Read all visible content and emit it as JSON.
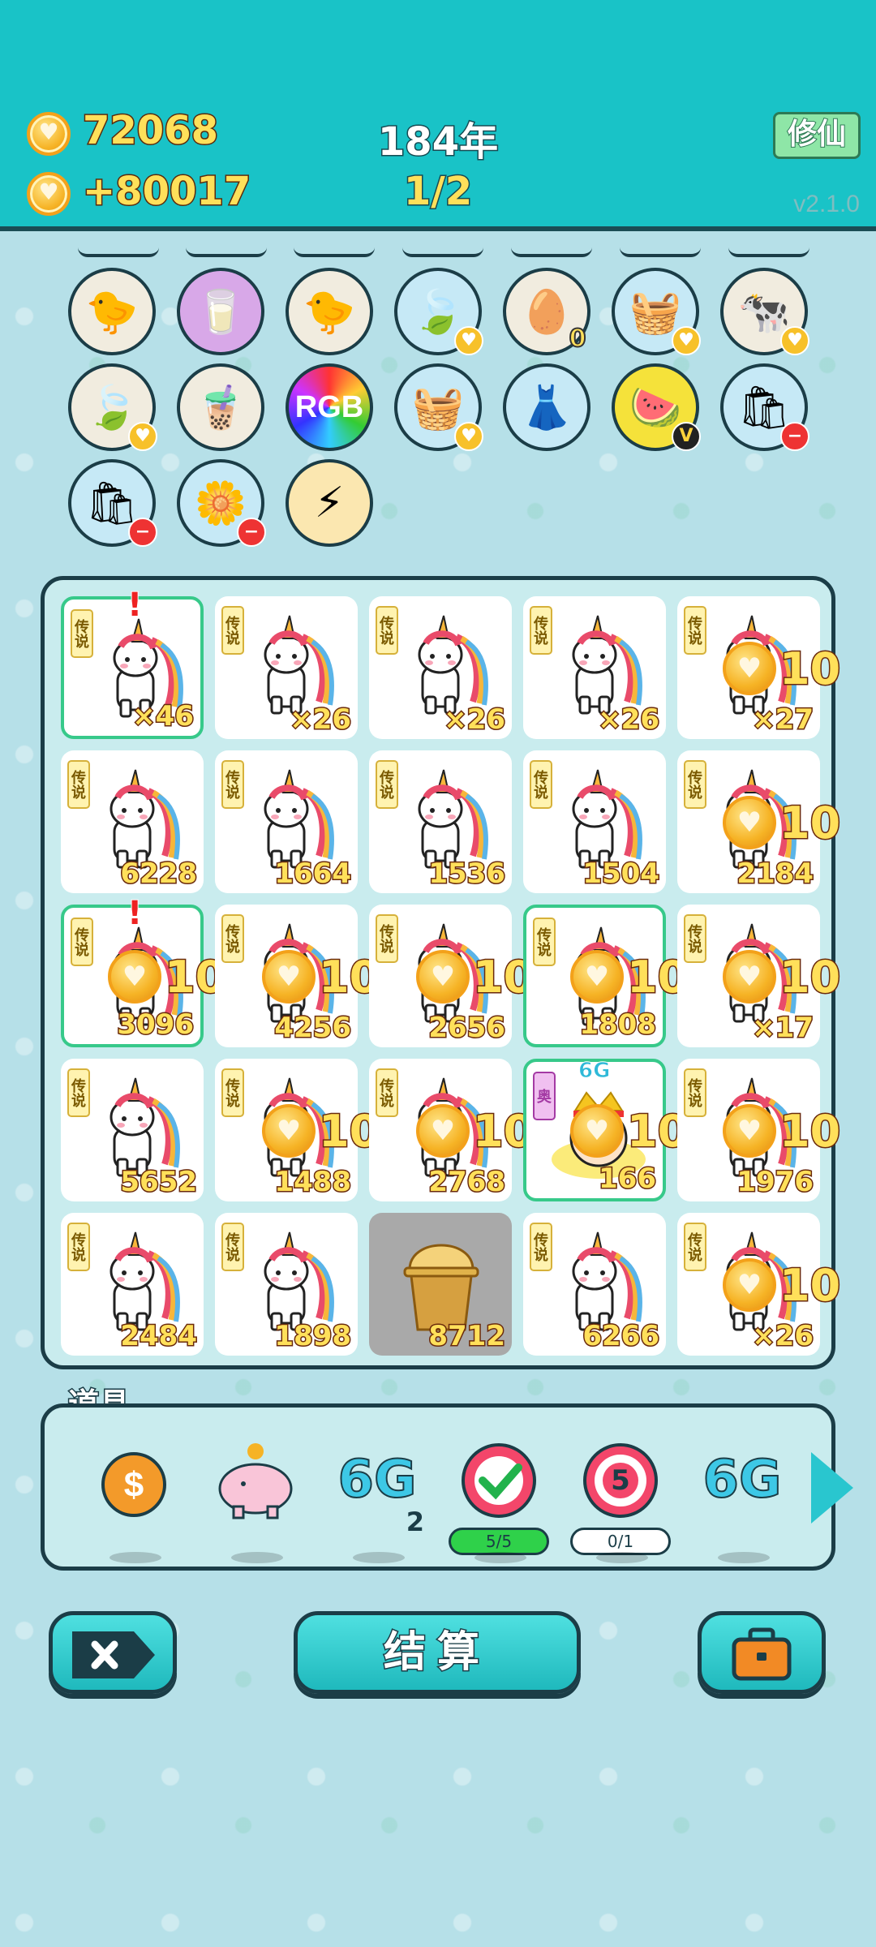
{
  "header": {
    "coins": "72068",
    "rate": "+80017",
    "year": "184年",
    "stage": "1/2",
    "mode_label": "修仙",
    "version": "v2.1.0"
  },
  "shelf": {
    "items": [
      {
        "icon": "chick-egg",
        "emoji": "🐤",
        "bg": "#f1ecdf",
        "badge": ""
      },
      {
        "icon": "milk-jug",
        "emoji": "🥛",
        "bg": "#d8a8e8",
        "badge": ""
      },
      {
        "icon": "chick-egg",
        "emoji": "🐤",
        "bg": "#f1ecdf",
        "badge": ""
      },
      {
        "icon": "leaf",
        "emoji": "🍃",
        "bg": "#c6e9f6",
        "badge": "heart"
      },
      {
        "icon": "egg-tray",
        "emoji": "🥚",
        "bg": "#f1ecdf",
        "badge": "0"
      },
      {
        "icon": "fruit-basket",
        "emoji": "🧺",
        "bg": "#c6e9f6",
        "badge": "heart"
      },
      {
        "icon": "cows",
        "emoji": "🐄",
        "bg": "#f1ecdf",
        "badge": "heart"
      },
      {
        "icon": "leaf",
        "emoji": "🍃",
        "bg": "#f1ecdf",
        "badge": "heart"
      },
      {
        "icon": "bubble-tea",
        "emoji": "🧋",
        "bg": "#f1ecdf",
        "badge": ""
      },
      {
        "icon": "rgb-orb",
        "emoji": "RGB",
        "bg": "#2a2a2a",
        "badge": ""
      },
      {
        "icon": "fruit-basket",
        "emoji": "🧺",
        "bg": "#c6e9f6",
        "badge": "heart"
      },
      {
        "icon": "skirt",
        "emoji": "👗",
        "bg": "#c6e9f6",
        "badge": ""
      },
      {
        "icon": "fruit-platter",
        "emoji": "🍉",
        "bg": "#f5e23a",
        "badge": "V"
      },
      {
        "icon": "sack",
        "emoji": "🛍",
        "bg": "#c6e9f6",
        "badge": "minus"
      },
      {
        "icon": "sack",
        "emoji": "🛍",
        "bg": "#c6e9f6",
        "badge": "minus"
      },
      {
        "icon": "flower-pot",
        "emoji": "🌼",
        "bg": "#c6e9f6",
        "badge": "minus"
      },
      {
        "icon": "lightning",
        "emoji": "⚡",
        "bg": "#fbe7b0",
        "badge": ""
      }
    ]
  },
  "board": {
    "legend_tag": "传说",
    "hero_tag": "奥",
    "float_value": "10",
    "hero_label": "6G",
    "cards": [
      {
        "count": "×46",
        "type": "unicorn",
        "selected": true,
        "alert": true,
        "coin": false
      },
      {
        "count": "×26",
        "type": "unicorn",
        "selected": false,
        "alert": false,
        "coin": false
      },
      {
        "count": "×26",
        "type": "unicorn",
        "selected": false,
        "alert": false,
        "coin": false
      },
      {
        "count": "×26",
        "type": "unicorn",
        "selected": false,
        "alert": false,
        "coin": false
      },
      {
        "count": "×27",
        "type": "unicorn",
        "selected": false,
        "alert": false,
        "coin": true
      },
      {
        "count": "6228",
        "type": "unicorn",
        "selected": false,
        "alert": false,
        "coin": false
      },
      {
        "count": "1664",
        "type": "unicorn",
        "selected": false,
        "alert": false,
        "coin": false
      },
      {
        "count": "1536",
        "type": "unicorn",
        "selected": false,
        "alert": false,
        "coin": false
      },
      {
        "count": "1504",
        "type": "unicorn",
        "selected": false,
        "alert": false,
        "coin": false
      },
      {
        "count": "2184",
        "type": "unicorn",
        "selected": false,
        "alert": false,
        "coin": true
      },
      {
        "count": "3096",
        "type": "unicorn",
        "selected": true,
        "alert": true,
        "coin": true
      },
      {
        "count": "4256",
        "type": "unicorn",
        "selected": false,
        "alert": false,
        "coin": true
      },
      {
        "count": "2656",
        "type": "unicorn",
        "selected": false,
        "alert": false,
        "coin": true
      },
      {
        "count": "1808",
        "type": "unicorn",
        "selected": true,
        "alert": false,
        "coin": true
      },
      {
        "count": "×17",
        "type": "unicorn",
        "selected": false,
        "alert": false,
        "coin": true
      },
      {
        "count": "5652",
        "type": "unicorn",
        "selected": false,
        "alert": false,
        "coin": false
      },
      {
        "count": "1488",
        "type": "unicorn",
        "selected": false,
        "alert": false,
        "coin": true
      },
      {
        "count": "2768",
        "type": "unicorn",
        "selected": false,
        "alert": false,
        "coin": true
      },
      {
        "count": "166",
        "type": "hero",
        "selected": true,
        "alert": false,
        "coin": true
      },
      {
        "count": "1976",
        "type": "unicorn",
        "selected": false,
        "alert": false,
        "coin": true
      },
      {
        "count": "2484",
        "type": "unicorn",
        "selected": false,
        "alert": false,
        "coin": false
      },
      {
        "count": "1898",
        "type": "unicorn",
        "selected": false,
        "alert": false,
        "coin": false
      },
      {
        "count": "8712",
        "type": "cup",
        "selected": false,
        "alert": false,
        "coin": false
      },
      {
        "count": "6266",
        "type": "unicorn",
        "selected": false,
        "alert": false,
        "coin": false
      },
      {
        "count": "×26",
        "type": "unicorn",
        "selected": false,
        "alert": false,
        "coin": true
      }
    ]
  },
  "props": {
    "title": "道具",
    "items": [
      {
        "name": "dollar-coin",
        "label": "",
        "sub": "",
        "pill": ""
      },
      {
        "name": "piggy-bank",
        "label": "",
        "sub": "",
        "pill": ""
      },
      {
        "name": "6g-boost",
        "label": "6G",
        "sub": "2",
        "pill": ""
      },
      {
        "name": "check-target",
        "label": "",
        "sub": "",
        "pill": "5/5"
      },
      {
        "name": "target-5",
        "label": "5",
        "sub": "",
        "pill": "0/1"
      },
      {
        "name": "6g-boost",
        "label": "6G",
        "sub": "",
        "pill": ""
      }
    ]
  },
  "buttons": {
    "settle": "结算"
  },
  "colors": {
    "teal": "#19c3c7",
    "coin_yellow": "#ffe05a",
    "outline": "#1b3d47",
    "select_green": "#37c98a"
  }
}
